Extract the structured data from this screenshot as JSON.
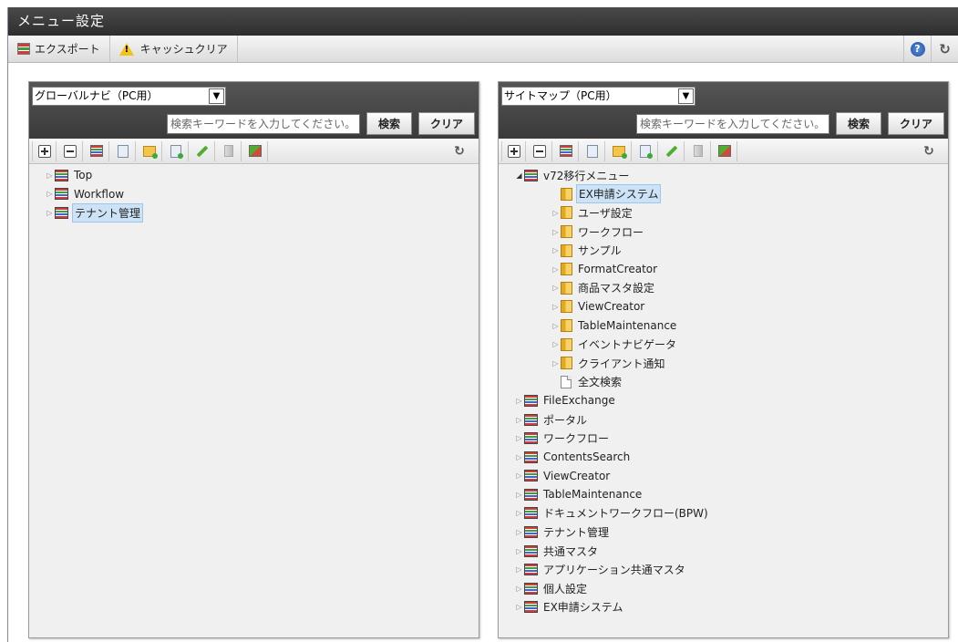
{
  "window": {
    "title": "メニュー設定"
  },
  "toolbar": {
    "export_label": "エクスポート",
    "cache_clear_label": "キャッシュクリア"
  },
  "left_panel": {
    "select_value": "グローバルナビ（PC用）",
    "search_placeholder": "検索キーワードを入力してください。",
    "search_label": "検索",
    "clear_label": "クリア",
    "tree": [
      {
        "label": "Top"
      },
      {
        "label": "Workflow"
      },
      {
        "label": "テナント管理",
        "selected": true
      }
    ]
  },
  "right_panel": {
    "select_value": "サイトマップ（PC用）",
    "search_placeholder": "検索キーワードを入力してください。",
    "search_label": "検索",
    "clear_label": "クリア",
    "tree_root": {
      "label": "v72移行メニュー",
      "expanded": true
    },
    "tree_children": [
      {
        "label": "EX申請システム",
        "icon": "folder-icon",
        "selected": true,
        "has_children": false
      },
      {
        "label": "ユーザ設定",
        "icon": "folder-icon"
      },
      {
        "label": "ワークフロー",
        "icon": "folder-icon"
      },
      {
        "label": "サンプル",
        "icon": "folder-icon"
      },
      {
        "label": "FormatCreator",
        "icon": "folder-icon"
      },
      {
        "label": "商品マスタ設定",
        "icon": "folder-icon"
      },
      {
        "label": "ViewCreator",
        "icon": "folder-icon"
      },
      {
        "label": "TableMaintenance",
        "icon": "folder-icon"
      },
      {
        "label": "イベントナビゲータ",
        "icon": "folder-icon"
      },
      {
        "label": "クライアント通知",
        "icon": "folder-icon"
      },
      {
        "label": "全文検索",
        "icon": "page-icon",
        "has_children": false
      }
    ],
    "tree_rest": [
      {
        "label": "FileExchange"
      },
      {
        "label": "ポータル"
      },
      {
        "label": "ワークフロー"
      },
      {
        "label": "ContentsSearch"
      },
      {
        "label": "ViewCreator"
      },
      {
        "label": "TableMaintenance"
      },
      {
        "label": "ドキュメントワークフロー(BPW)"
      },
      {
        "label": "テナント管理"
      },
      {
        "label": "共通マスタ"
      },
      {
        "label": "アプリケーション共通マスタ"
      },
      {
        "label": "個人設定"
      },
      {
        "label": "EX申請システム"
      }
    ]
  },
  "icons": {
    "tree_toolbar": [
      "expand-all-icon",
      "collapse-all-icon",
      "add-menu-icon",
      "add-item-icon",
      "add-folder-icon",
      "add-page-icon",
      "edit-icon",
      "delete-icon",
      "import-icon",
      "refresh-icon"
    ]
  }
}
